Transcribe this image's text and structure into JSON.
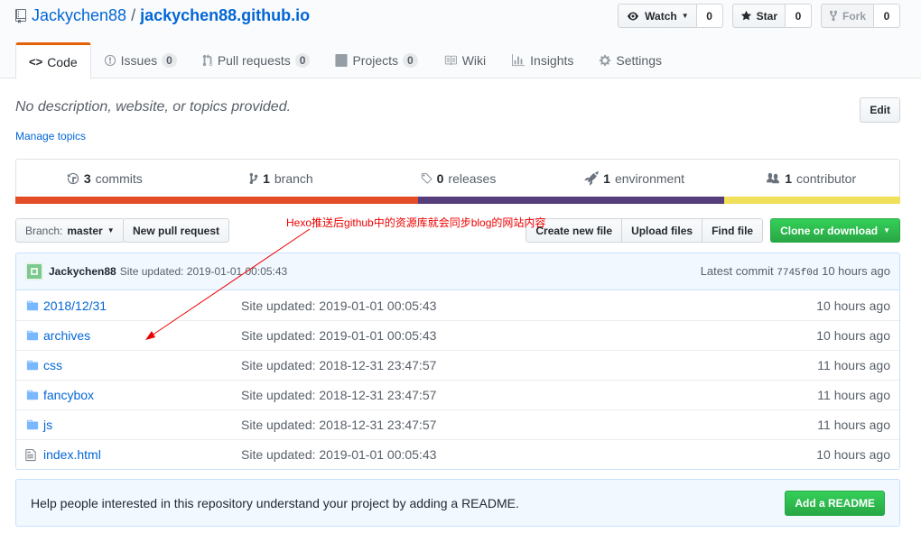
{
  "header": {
    "owner": "Jackychen88",
    "separator": "/",
    "repo": "jackychen88.github.io",
    "watch": {
      "label": "Watch",
      "count": "0"
    },
    "star": {
      "label": "Star",
      "count": "0"
    },
    "fork": {
      "label": "Fork",
      "count": "0"
    }
  },
  "tabs": [
    {
      "label": "Code",
      "icon": "code-icon"
    },
    {
      "label": "Issues",
      "count": "0",
      "icon": "issue-icon"
    },
    {
      "label": "Pull requests",
      "count": "0",
      "icon": "pull-request-icon"
    },
    {
      "label": "Projects",
      "count": "0",
      "icon": "project-icon"
    },
    {
      "label": "Wiki",
      "icon": "book-icon"
    },
    {
      "label": "Insights",
      "icon": "graph-icon"
    },
    {
      "label": "Settings",
      "icon": "gear-icon"
    }
  ],
  "description": {
    "text": "No description, website, or topics provided.",
    "manage_topics": "Manage topics",
    "edit": "Edit"
  },
  "summary": {
    "commits": {
      "count": "3",
      "label": "commits"
    },
    "branch": {
      "count": "1",
      "label": "branch"
    },
    "releases": {
      "count": "0",
      "label": "releases"
    },
    "environment": {
      "count": "1",
      "label": "environment"
    },
    "contributor": {
      "count": "1",
      "label": "contributor"
    },
    "language_colors": [
      "#e34c26",
      "#563d7c",
      "#f1e05a"
    ],
    "language_shares": [
      0.455,
      0.346,
      0.199
    ]
  },
  "filenav": {
    "branch_prefix": "Branch:",
    "branch_name": "master",
    "new_pull_request": "New pull request",
    "create_new_file": "Create new file",
    "upload_files": "Upload files",
    "find_file": "Find file",
    "clone_or_download": "Clone or download"
  },
  "annotation": "Hexo推送后github中的资源库就会同步blog的网站内容",
  "commit": {
    "author": "Jackychen88",
    "message": "Site updated: 2019-01-01 00:05:43",
    "latest_label": "Latest commit",
    "sha": "7745f0d",
    "age": "10 hours ago"
  },
  "files": [
    {
      "name": "2018/12/31",
      "type": "directory",
      "message": "Site updated: 2019-01-01 00:05:43",
      "age": "10 hours ago"
    },
    {
      "name": "archives",
      "type": "directory",
      "message": "Site updated: 2019-01-01 00:05:43",
      "age": "10 hours ago"
    },
    {
      "name": "css",
      "type": "directory",
      "message": "Site updated: 2018-12-31 23:47:57",
      "age": "11 hours ago"
    },
    {
      "name": "fancybox",
      "type": "directory",
      "message": "Site updated: 2018-12-31 23:47:57",
      "age": "11 hours ago"
    },
    {
      "name": "js",
      "type": "directory",
      "message": "Site updated: 2018-12-31 23:47:57",
      "age": "11 hours ago"
    },
    {
      "name": "index.html",
      "type": "file",
      "message": "Site updated: 2019-01-01 00:05:43",
      "age": "10 hours ago"
    }
  ],
  "readme_prompt": {
    "text": "Help people interested in this repository understand your project by adding a README.",
    "button": "Add a README"
  }
}
